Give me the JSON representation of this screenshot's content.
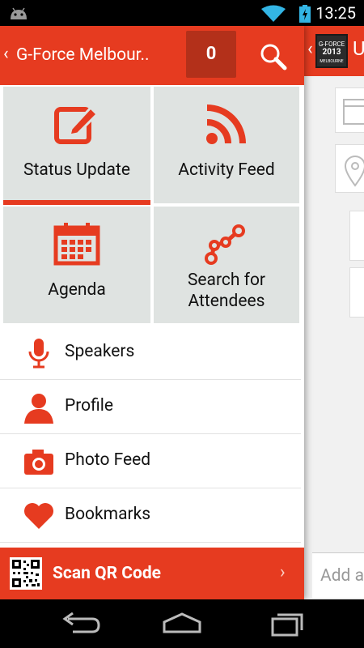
{
  "status_bar": {
    "time": "13:25"
  },
  "drawer": {
    "title": "G-Force Melbour..",
    "counter": "0",
    "tiles": [
      {
        "label": "Status Update"
      },
      {
        "label": "Activity Feed"
      },
      {
        "label": "Agenda"
      },
      {
        "label_line1": "Search for",
        "label_line2": "Attendees"
      }
    ],
    "list": [
      {
        "label": "Speakers"
      },
      {
        "label": "Profile"
      },
      {
        "label": "Photo Feed"
      },
      {
        "label": "Bookmarks"
      }
    ],
    "qr": {
      "label": "Scan QR Code"
    }
  },
  "right_panel": {
    "title_partial": "U",
    "logo_text": "G-FORCE",
    "logo_year": "2013",
    "logo_city": "MELBOURNE",
    "input_placeholder": "Add a"
  },
  "colors": {
    "brand_red": "#e63b20",
    "tile_bg": "#dfe3e1"
  }
}
